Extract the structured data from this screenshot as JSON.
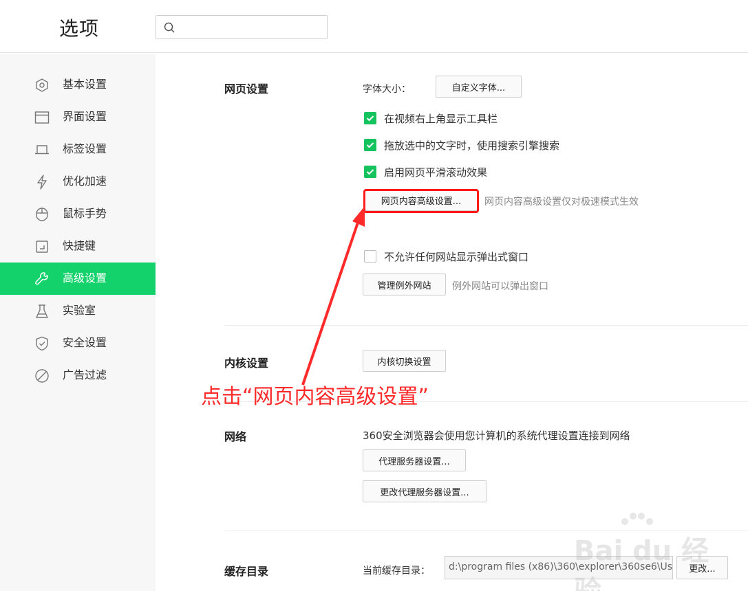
{
  "header": {
    "title": "选项",
    "search": {
      "value": "",
      "placeholder": ""
    }
  },
  "sidebar": {
    "items": [
      {
        "label": "基本设置",
        "icon": "hexagon-icon"
      },
      {
        "label": "界面设置",
        "icon": "window-icon"
      },
      {
        "label": "标签设置",
        "icon": "tab-icon"
      },
      {
        "label": "优化加速",
        "icon": "lightning-icon"
      },
      {
        "label": "鼠标手势",
        "icon": "mouse-icon"
      },
      {
        "label": "快捷键",
        "icon": "shortcut-icon"
      },
      {
        "label": "高级设置",
        "icon": "wrench-icon",
        "active": true
      },
      {
        "label": "实验室",
        "icon": "flask-icon"
      },
      {
        "label": "安全设置",
        "icon": "shield-icon"
      },
      {
        "label": "广告过滤",
        "icon": "ban-icon"
      }
    ]
  },
  "webpage": {
    "title": "网页设置",
    "font_size_label": "字体大小：",
    "custom_font_button": "自定义字体...",
    "checkboxes": [
      {
        "label": "在视频右上角显示工具栏",
        "checked": true
      },
      {
        "label": "拖放选中的文字时，使用搜索引擎搜索",
        "checked": true
      },
      {
        "label": "启用网页平滑滚动效果",
        "checked": true
      }
    ],
    "advanced_button": "网页内容高级设置...",
    "advanced_hint": "网页内容高级设置仅对极速模式生效",
    "popup_checkbox": {
      "label": "不允许任何网站显示弹出式窗口",
      "checked": false
    },
    "manage_exceptions_button": "管理例外网站",
    "exceptions_hint": "例外网站可以弹出窗口"
  },
  "kernel": {
    "title": "内核设置",
    "switch_button": "内核切换设置"
  },
  "annotation": {
    "text": "点击“网页内容高级设置”"
  },
  "network": {
    "title": "网络",
    "description": "360安全浏览器会使用您计算机的系统代理设置连接到网络",
    "proxy_button": "代理服务器设置...",
    "change_proxy_button": "更改代理服务器设置..."
  },
  "cache": {
    "title": "缓存目录",
    "current_label": "当前缓存目录：",
    "path_value": "d:\\program files (x86)\\360\\explorer\\360se6\\Us",
    "change_button": "更改..."
  },
  "watermark": {
    "text": "Bai du 经验"
  },
  "colors": {
    "accent": "#14d26b",
    "checkbox": "#14c35e",
    "annotation": "#ff2b2b"
  }
}
